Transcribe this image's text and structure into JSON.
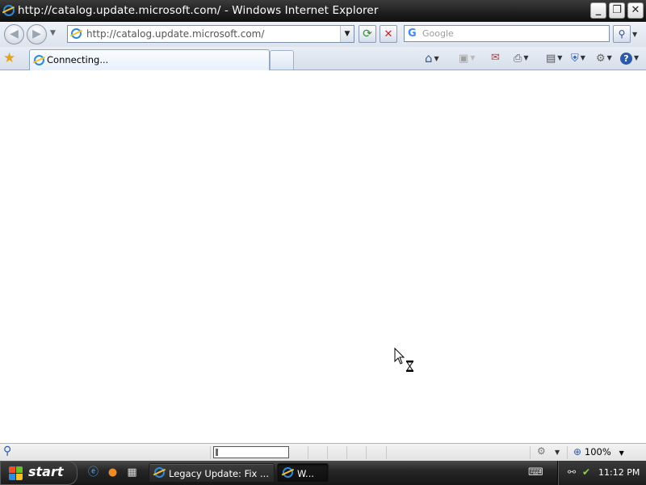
{
  "window": {
    "title": "http://catalog.update.microsoft.com/ - Windows Internet Explorer",
    "controls": {
      "minimize_icon": "minimize-icon",
      "restore_icon": "restore-icon",
      "close_icon": "close-icon"
    }
  },
  "address_bar": {
    "url": "http://catalog.update.microsoft.com/"
  },
  "search": {
    "placeholder": "Google"
  },
  "tabs": [
    {
      "label": "Connecting...",
      "active": true
    }
  ],
  "status_bar": {
    "zoom": "100%",
    "progress": 0.03
  },
  "taskbar": {
    "start_label": "start",
    "items": [
      {
        "label": "Legacy Update: Fix ...",
        "icon": "ie-icon",
        "active": false
      },
      {
        "label": "W...",
        "icon": "ie-icon",
        "active": true
      }
    ],
    "clock": "11:12 PM"
  },
  "colors": {
    "title_bar": "#1e1e1e",
    "toolbar": "#dde4ee",
    "taskbar": "#262626",
    "ie_blue": "#2e8ad8"
  }
}
